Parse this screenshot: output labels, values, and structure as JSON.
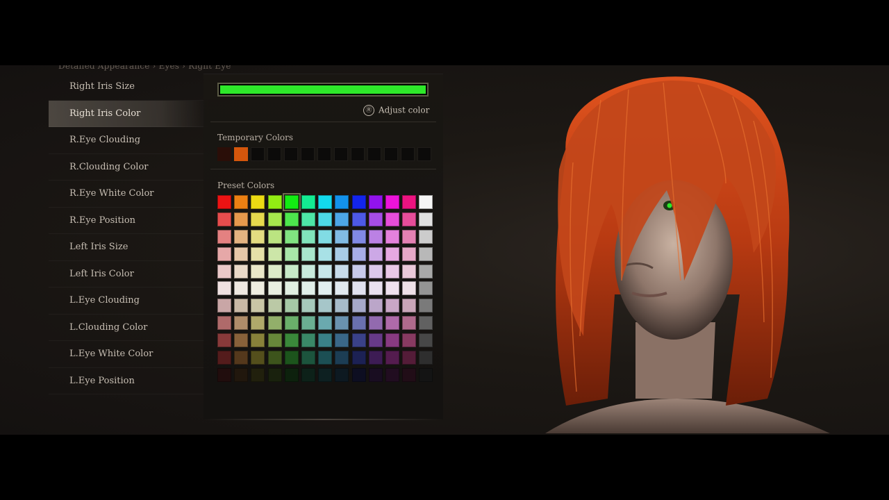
{
  "breadcrumb": "Detailed Appearance  ›  Eyes  ›  Right Eye",
  "menu": {
    "items": [
      {
        "label": "Right Iris Size",
        "selected": false
      },
      {
        "label": "Right Iris Color",
        "selected": true
      },
      {
        "label": "R.Eye Clouding",
        "selected": false
      },
      {
        "label": "R.Clouding Color",
        "selected": false
      },
      {
        "label": "R.Eye White Color",
        "selected": false
      },
      {
        "label": "R.Eye Position",
        "selected": false
      },
      {
        "label": "Left Iris Size",
        "selected": false
      },
      {
        "label": "Left Iris Color",
        "selected": false
      },
      {
        "label": "L.Eye Clouding",
        "selected": false
      },
      {
        "label": "L.Clouding Color",
        "selected": false
      },
      {
        "label": "L.Eye White Color",
        "selected": false
      },
      {
        "label": "L.Eye Position",
        "selected": false
      }
    ]
  },
  "color_panel": {
    "current_color": "#2ee82a",
    "adjust_label": "Adjust color",
    "adjust_button_glyph": "Ⓡ",
    "temporary_label": "Temporary Colors",
    "temporary_colors": [
      "#2a0e08",
      "#d4560c",
      "",
      "",
      "",
      "",
      "",
      "",
      "",
      "",
      "",
      "",
      ""
    ],
    "preset_label": "Preset Colors",
    "preset_selected": {
      "row": 0,
      "col": 4
    }
  },
  "colors": {
    "preset_hues": [
      0,
      30,
      55,
      85,
      120,
      155,
      185,
      205,
      235,
      275,
      305,
      330,
      -1
    ]
  }
}
